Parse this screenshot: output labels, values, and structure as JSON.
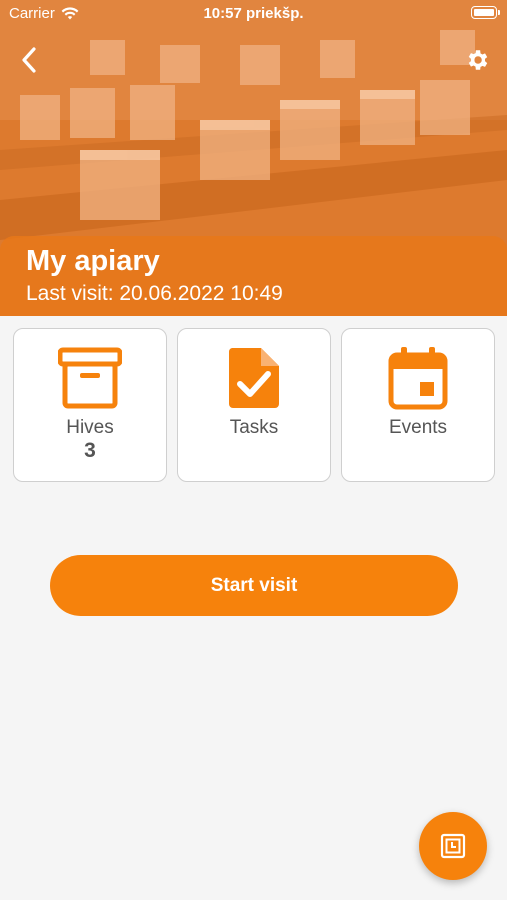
{
  "status_bar": {
    "carrier": "Carrier",
    "time": "10:57 priekšp."
  },
  "header": {
    "title": "My apiary",
    "subtitle": "Last visit: 20.06.2022 10:49",
    "back_icon": "chevron-left-icon",
    "settings_icon": "gear-icon"
  },
  "tiles": [
    {
      "label": "Hives",
      "count": "3",
      "icon": "hive-box-icon"
    },
    {
      "label": "Tasks",
      "count": "",
      "icon": "task-document-icon"
    },
    {
      "label": "Events",
      "count": "",
      "icon": "calendar-icon"
    }
  ],
  "actions": {
    "start_visit_label": "Start visit",
    "fab_icon": "nfc-scan-icon"
  },
  "colors": {
    "accent": "#f6820c",
    "background": "#f5f5f5",
    "tile_border": "#cfcfcf",
    "text_muted": "#555555"
  }
}
